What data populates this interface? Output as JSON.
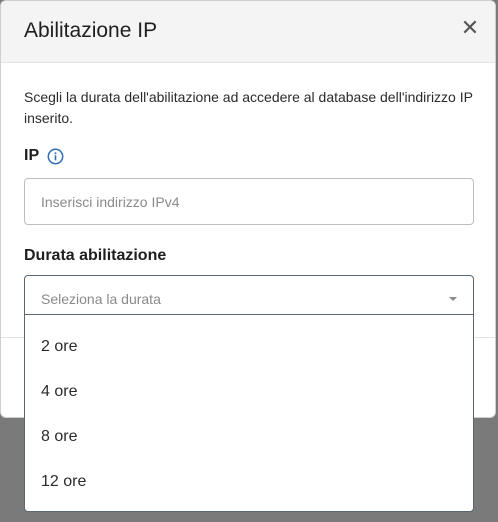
{
  "modal": {
    "title": "Abilitazione IP",
    "close_icon": "close-icon",
    "description": "Scegli la durata dell'abilitazione ad accedere al database dell'indirizzo IP inserito."
  },
  "ip_field": {
    "label": "IP",
    "info_icon": "info-icon",
    "placeholder": "Inserisci indirizzo IPv4",
    "value": ""
  },
  "duration_field": {
    "label": "Durata abilitazione",
    "placeholder": "Seleziona la durata",
    "caret_icon": "caret-down-icon",
    "options": [
      "2 ore",
      "4 ore",
      "8 ore",
      "12 ore"
    ]
  },
  "colors": {
    "accent": "#2f6db5",
    "overlay": "#7a7a7a",
    "header_bg": "#f4f4f4"
  }
}
